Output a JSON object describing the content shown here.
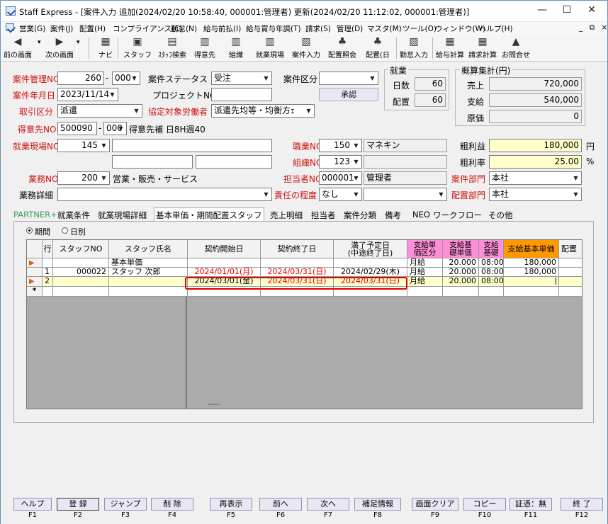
{
  "title": "Staff Express - [案件入力 追加(2024/02/20 10:58:40, 000001:管理者) 更新(2024/02/20 11:12:02, 000001:管理者)]",
  "window_controls": {
    "minimize": "—",
    "maximize": "☐",
    "close": "✕"
  },
  "menu": [
    "営業(G)",
    "案件(J)",
    "配置(H)",
    "コンプライアンス(C)",
    "勤怠(N)",
    "給与前払(I)",
    "給与賞与年調(T)",
    "請求(S)",
    "管理(D)",
    "マスタ(M)",
    "ツール(O)",
    "ウィンドウ(W)",
    "ヘルプ(H)"
  ],
  "menu_right": "_ ⧉ ×",
  "toolbar": [
    "前の画面",
    "次の画面",
    "ナビ",
    "スタッフ",
    "ｽﾀｯﾌ検索",
    "得意先",
    "組織",
    "就業現場",
    "案件入力",
    "配置照会",
    "配置(日",
    "勤怠入力",
    "給与計算",
    "請求計算",
    "お問合せ"
  ],
  "form": {
    "case_no_label": "案件管理NO",
    "case_no": "260",
    "case_no_sub": "000",
    "status_label": "案件ステータス",
    "status": "受注",
    "kubun_label": "案件区分",
    "kubun": "",
    "ym_label": "案件年月日",
    "ym": "2023/11/14",
    "project_label": "プロジェクトNO",
    "project": "",
    "approve": "承認",
    "torihiki_label": "取引区分",
    "torihiki": "派遣",
    "kyotei_label": "協定対象労働者",
    "kyotei": "派遣先均等・均衡方ｪ",
    "tokui_label": "得意先NO",
    "tokui_no": "500090",
    "tokui_sub": "000",
    "tokui_name": "得意先補 日8H週40",
    "genba_label": "就業現場NO",
    "genba_no": "145",
    "genba_name": "",
    "genba_extra1": "",
    "genba_extra2": "",
    "shokusyu_label": "職業NO",
    "shokusyu_no": "150",
    "shokusyu_name": "マネキン",
    "soshiki_label": "組織NO",
    "soshiki_no": "123",
    "soshiki_name": "",
    "gyomu_label": "業務NO",
    "gyomu_no": "200",
    "gyomu_name": "営業・販売・サービス",
    "tanto_label": "担当者NO",
    "tanto_no": "000001",
    "tanto_name": "管理者",
    "bumon_label": "案件部門",
    "bumon": "本社",
    "gyomu_detail_label": "業務詳細",
    "gyomu_detail": "",
    "sekinin_label": "責任の程度",
    "sekinin": "なし",
    "sekinin2": "",
    "haichi_bumon_label": "配置部門",
    "haichi_bumon": "本社"
  },
  "shugyo": {
    "title": "就業",
    "days_label": "日数",
    "days": "60",
    "haichi_label": "配置",
    "haichi": "60"
  },
  "gaisan": {
    "title": "概算集計(円)",
    "uriage_label": "売上",
    "uriage": "720,000",
    "shikyu_label": "支給",
    "shikyu": "540,000",
    "genka_label": "原価",
    "genka": "0",
    "arari_label": "粗利益",
    "arari": "180,000",
    "arari_unit": "円",
    "ritsu_label": "粗利率",
    "ritsu": "25.00",
    "ritsu_unit": "%"
  },
  "tabs": [
    "PARTNER+",
    "就業条件",
    "就業現場詳細",
    "基本単価・期間配置スタッフ",
    "売上明細",
    "担当者",
    "案件分類",
    "備考",
    "NEO",
    "ワークフロー",
    "その他"
  ],
  "radio": {
    "kikan": "期間",
    "hibetsu": "日別"
  },
  "grid": {
    "headers": [
      "行",
      "スタッフNO",
      "スタッフ氏名",
      "契約開始日",
      "契約終了日",
      "満了予定日\n(中途終了日)",
      "支給単\n価区分",
      "支給基\n礎単価",
      "支給\n基礎",
      "支給基本単価",
      "配置"
    ],
    "row0": {
      "gyo": "",
      "staff_no": "",
      "staff_name": "基本単価",
      "start": "",
      "end": "",
      "manryo": "",
      "kubun": "月給",
      "kiso": "20.000",
      "kiso2": "08:00",
      "kihon": "180,000"
    },
    "row1": {
      "gyo": "1",
      "staff_no": "000022",
      "staff_name": "スタッフ 次郎",
      "start": "2024/01/01(月)",
      "end": "2024/03/31(日)",
      "manryo": "2024/02/29(木)",
      "kubun": "月給",
      "kiso": "20.000",
      "kiso2": "08:00",
      "kihon": "180,000"
    },
    "row2": {
      "gyo": "2",
      "staff_no": "",
      "staff_name": "",
      "start": "2024/03/01(金)",
      "end": "2024/03/31(日)",
      "manryo": "2024/03/31(日)",
      "kubun": "月給",
      "kiso": "20.000",
      "kiso2": "08:00",
      "kihon": ""
    },
    "newrow": "*"
  },
  "fkeys": [
    {
      "label": "ヘルプ",
      "key": "F1"
    },
    {
      "label": "登 録",
      "key": "F2"
    },
    {
      "label": "ジャンプ",
      "key": "F3"
    },
    {
      "label": "削 除",
      "key": "F4"
    },
    {
      "label": "再表示",
      "key": "F5"
    },
    {
      "label": "前へ",
      "key": "F6"
    },
    {
      "label": "次へ",
      "key": "F7"
    },
    {
      "label": "補足情報",
      "key": "F8"
    },
    {
      "label": "画面クリア",
      "key": "F9"
    },
    {
      "label": "コピー",
      "key": "F10"
    },
    {
      "label": "証憑：無",
      "key": "F11"
    },
    {
      "label": "終 了",
      "key": "F12"
    }
  ]
}
